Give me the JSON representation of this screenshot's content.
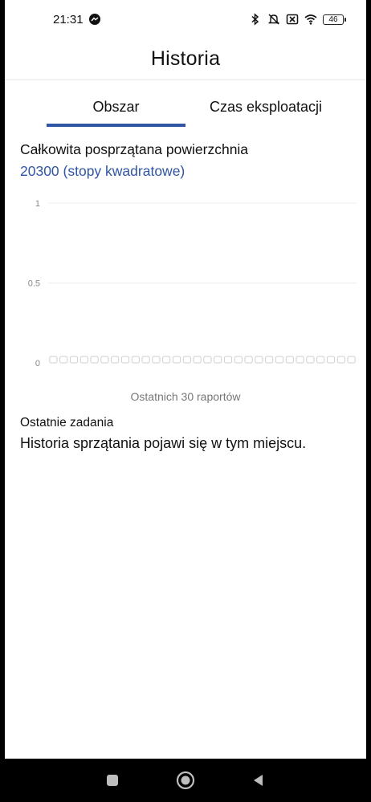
{
  "status_bar": {
    "time": "21:31",
    "battery_level": "46",
    "icons": [
      "messenger-icon",
      "bluetooth-icon",
      "mute-icon",
      "signal-x-icon",
      "wifi-icon",
      "battery-icon"
    ]
  },
  "header": {
    "title": "Historia"
  },
  "tabs": [
    {
      "label": "Obszar",
      "active": true
    },
    {
      "label": "Czas eksploatacji",
      "active": false
    }
  ],
  "summary": {
    "label": "Całkowita posprzątana powierzchnia",
    "value": "20300 (stopy kwadratowe)"
  },
  "chart_data": {
    "type": "bar",
    "categories_count": 30,
    "values": [
      0,
      0,
      0,
      0,
      0,
      0,
      0,
      0,
      0,
      0,
      0,
      0,
      0,
      0,
      0,
      0,
      0,
      0,
      0,
      0,
      0,
      0,
      0,
      0,
      0,
      0,
      0,
      0,
      0,
      0
    ],
    "yticks": [
      "0",
      "0.5",
      "1"
    ],
    "ylim": [
      0,
      1
    ],
    "xlabel": "Ostatnich 30 raportów",
    "grid": true
  },
  "recent": {
    "title": "Ostatnie zadania",
    "empty_text": "Historia sprzątania pojawi się w tym miejscu."
  },
  "nav": {
    "icons": [
      "recents-square-icon",
      "home-circle-icon",
      "back-triangle-icon"
    ]
  },
  "colors": {
    "accent": "#2f55a4",
    "grid": "#ececec",
    "bar_outline": "#cfcfcf"
  }
}
